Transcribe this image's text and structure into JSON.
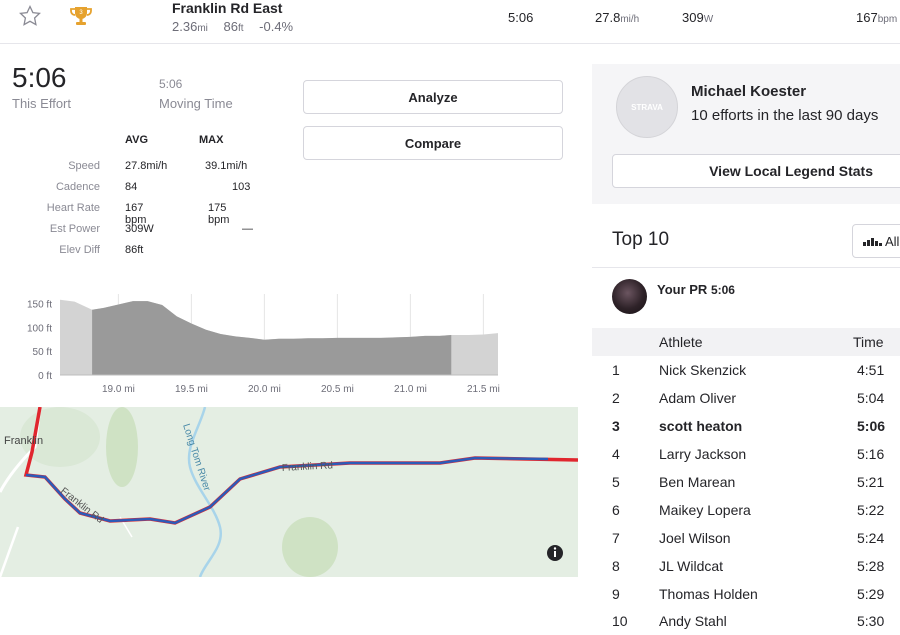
{
  "segment": {
    "name": "Franklin Rd East",
    "distance": "2.36",
    "distance_unit": "mi",
    "elev": "86",
    "elev_unit": "ft",
    "grade": "-0.4%",
    "rank_badge": "3",
    "time": "5:06",
    "speed": "27.8",
    "speed_unit": "mi/h",
    "power": "309",
    "power_unit": "W",
    "hr": "167",
    "hr_unit": "bpm"
  },
  "effort": {
    "time": "5:06",
    "time_label": "This Effort",
    "moving_time": "5:06",
    "moving_label": "Moving Time"
  },
  "buttons": {
    "analyze": "Analyze",
    "compare": "Compare"
  },
  "stats": {
    "avg_header": "AVG",
    "max_header": "MAX",
    "rows": [
      {
        "label": "Speed",
        "avg": "27.8mi/h",
        "max": "39.1mi/h"
      },
      {
        "label": "Cadence",
        "avg": "84",
        "max": "103"
      },
      {
        "label": "Heart Rate",
        "avg": "167 bpm",
        "max": "175 bpm"
      },
      {
        "label": "Est Power",
        "avg": "309W",
        "max": "—"
      },
      {
        "label": "Elev Diff",
        "avg": "86ft",
        "max": ""
      }
    ]
  },
  "chart_data": {
    "type": "area",
    "xlabel": "",
    "ylabel": "",
    "x_ticks": [
      "19.0 mi",
      "19.5 mi",
      "20.0 mi",
      "20.5 mi",
      "21.0 mi",
      "21.5 mi"
    ],
    "y_ticks": [
      "0 ft",
      "50 ft",
      "100 ft",
      "150 ft"
    ],
    "xlim": [
      18.6,
      21.6
    ],
    "ylim": [
      0,
      170
    ],
    "highlight_range": [
      18.82,
      21.28
    ],
    "x": [
      18.6,
      18.7,
      18.82,
      18.9,
      19.0,
      19.1,
      19.2,
      19.3,
      19.4,
      19.5,
      19.6,
      19.7,
      19.8,
      19.9,
      20.0,
      20.1,
      20.2,
      20.3,
      20.4,
      20.5,
      20.6,
      20.7,
      20.8,
      20.9,
      21.0,
      21.1,
      21.2,
      21.28,
      21.4,
      21.5,
      21.6
    ],
    "y": [
      158,
      154,
      137,
      141,
      148,
      155,
      155,
      147,
      123,
      108,
      95,
      86,
      81,
      78,
      74,
      76,
      76,
      77,
      77,
      78,
      78,
      78,
      78,
      79,
      80,
      82,
      82,
      84,
      84,
      85,
      88
    ]
  },
  "map": {
    "labels": [
      "Franklin",
      "Franklin Rd",
      "Long Tom River",
      "Franklin Rd"
    ],
    "info_icon": "info-icon"
  },
  "legend": {
    "name": "Michael Koester",
    "subtitle": "10 efforts in the last 90 days",
    "button": "View Local Legend Stats",
    "badge_text": "STRAVA"
  },
  "top10": {
    "title": "Top 10",
    "filter_label": "All",
    "pr_label": "Your PR",
    "pr_time": "5:06",
    "col_athlete": "Athlete",
    "col_time": "Time",
    "rows": [
      {
        "rank": "1",
        "name": "Nick Skenzick",
        "time": "4:51"
      },
      {
        "rank": "2",
        "name": "Adam Oliver",
        "time": "5:04"
      },
      {
        "rank": "3",
        "name": "scott heaton",
        "time": "5:06"
      },
      {
        "rank": "4",
        "name": "Larry Jackson",
        "time": "5:16"
      },
      {
        "rank": "5",
        "name": "Ben Marean",
        "time": "5:21"
      },
      {
        "rank": "6",
        "name": "Maikey Lopera",
        "time": "5:22"
      },
      {
        "rank": "7",
        "name": "Joel Wilson",
        "time": "5:24"
      },
      {
        "rank": "8",
        "name": "JL Wildcat",
        "time": "5:28"
      },
      {
        "rank": "9",
        "name": "Thomas Holden",
        "time": "5:29"
      },
      {
        "rank": "10",
        "name": "Andy Stahl",
        "time": "5:30"
      }
    ]
  },
  "colors": {
    "trophy": "#e6a22e",
    "route_red": "#e0262e",
    "route_blue": "#2c5bb8",
    "elev_fill": "#9a9a9a",
    "elev_fill_light": "#d3d3d3"
  }
}
